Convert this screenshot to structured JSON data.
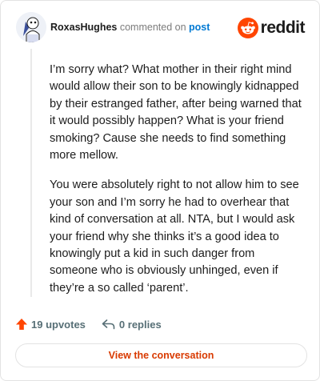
{
  "header": {
    "username": "RoxasHughes",
    "action_text": "commented on",
    "post_link": "post",
    "brand_name": "reddit",
    "brand_icon": "reddit-snoo-icon",
    "avatar": "avatar-image"
  },
  "comment": {
    "paragraphs": [
      "I’m sorry what? What mother in their right mind would allow their son to be knowingly kidnapped by their estranged father, after being warned that it would possibly happen? What is your friend smoking? Cause she needs to find something more mellow.",
      "You were absolutely right to not allow him to see your son and I’m sorry he had to overhear that kind of conversation at all. NTA, but I would ask your friend why she thinks it’s a good idea to knowingly put a kid in such danger from someone who is obviously unhinged, even if they’re a so called ‘parent’."
    ]
  },
  "footer": {
    "upvotes_label": "19 upvotes",
    "replies_label": "0 replies",
    "upvote_icon": "upvote-arrow-icon",
    "reply_icon": "reply-icon"
  },
  "button": {
    "view_label": "View the conversation"
  },
  "colors": {
    "brand_orange": "#ff4500",
    "link_blue": "#0079d3",
    "button_text": "#d93a00",
    "meta_gray": "#576f76"
  }
}
